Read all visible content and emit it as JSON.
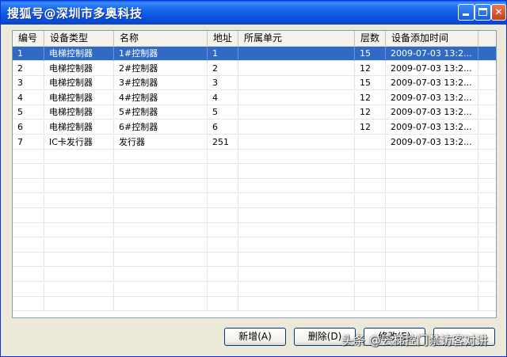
{
  "window": {
    "title": "搜狐号@深圳市多奥科技"
  },
  "table": {
    "columns": [
      "编号",
      "设备类型",
      "名称",
      "地址",
      "所属单元",
      "层数",
      "设备添加时间"
    ],
    "rows": [
      [
        "1",
        "电梯控制器",
        "1#控制器",
        "1",
        "",
        "15",
        "2009-07-03 13:2..."
      ],
      [
        "2",
        "电梯控制器",
        "2#控制器",
        "2",
        "",
        "12",
        "2009-07-03 13:2..."
      ],
      [
        "3",
        "电梯控制器",
        "3#控制器",
        "3",
        "",
        "15",
        "2009-07-03 13:2..."
      ],
      [
        "4",
        "电梯控制器",
        "4#控制器",
        "4",
        "",
        "12",
        "2009-07-03 13:2..."
      ],
      [
        "5",
        "电梯控制器",
        "5#控制器",
        "5",
        "",
        "12",
        "2009-07-03 13:2..."
      ],
      [
        "6",
        "电梯控制器",
        "6#控制器",
        "6",
        "",
        "12",
        "2009-07-03 13:2..."
      ],
      [
        "7",
        "IC卡发行器",
        "发行器",
        "251",
        "",
        "",
        "2009-07-03 13:2..."
      ]
    ],
    "selected_row": 1
  },
  "buttons": {
    "add": "新增",
    "add_key": "(A)",
    "delete": "删除",
    "delete_key": "(D)",
    "third_partial": "修改(E)"
  },
  "watermark": "头条 @云梯控门禁访客对讲",
  "colors": {
    "selection": "#316ac5",
    "titlebar": "#0b52e0"
  }
}
